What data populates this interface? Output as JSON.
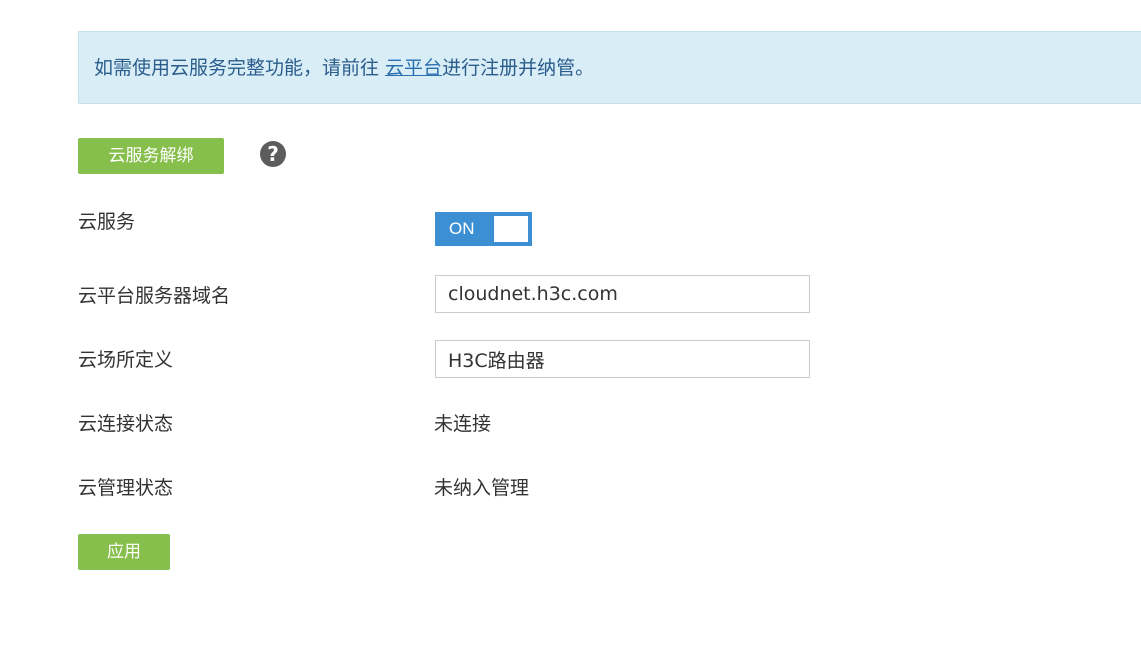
{
  "notice": {
    "prefix": "如需使用云服务完整功能，请前往 ",
    "link": "云平台",
    "suffix": "进行注册并纳管。"
  },
  "toolbar": {
    "unbind_label": "云服务解绑",
    "help_glyph": "?"
  },
  "form": {
    "cloud_service": {
      "label": "云服务",
      "toggle_text": "ON",
      "enabled": true
    },
    "server_domain": {
      "label": "云平台服务器域名",
      "value": "cloudnet.h3c.com"
    },
    "site_name": {
      "label": "云场所定义",
      "value": "H3C路由器"
    },
    "connection_status": {
      "label": "云连接状态",
      "value": "未连接"
    },
    "management_status": {
      "label": "云管理状态",
      "value": "未纳入管理"
    }
  },
  "actions": {
    "apply_label": "应用"
  },
  "colors": {
    "green_button": "#86bf4b",
    "toggle_blue": "#3d8fd4",
    "notice_bg": "#d9edf7"
  },
  "icons": {
    "help": "question-circle-icon"
  }
}
